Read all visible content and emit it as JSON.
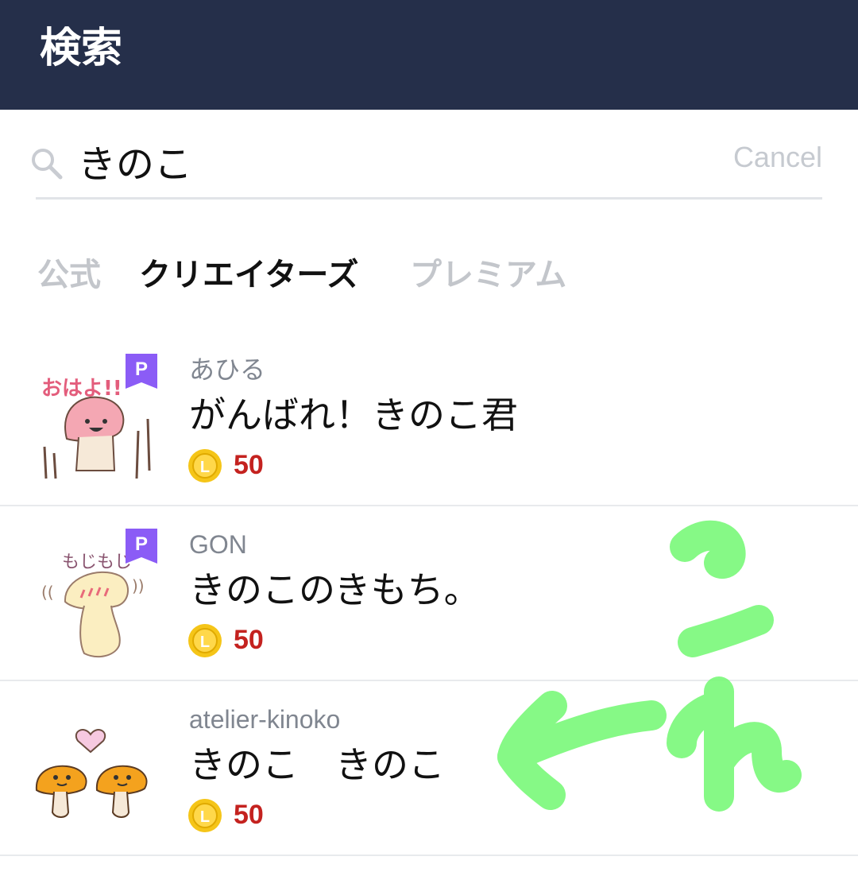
{
  "header": {
    "title": "検索"
  },
  "search": {
    "query": "きのこ",
    "cancel_label": "Cancel"
  },
  "tabs": [
    {
      "label": "公式",
      "active": false
    },
    {
      "label": "クリエイターズ",
      "active": true
    },
    {
      "label": "プレミアム",
      "active": false
    }
  ],
  "results": [
    {
      "author": "あひる",
      "title": "がんばれ！きのこ君",
      "price": "50",
      "premium_badge": "P",
      "thumb_text": "おはよ!!"
    },
    {
      "author": "GON",
      "title": "きのこのきもち。",
      "price": "50",
      "premium_badge": "P",
      "thumb_text": "もじもじ"
    },
    {
      "author": "atelier-kinoko",
      "title": "きのこ　きのこ",
      "price": "50"
    }
  ],
  "coin_letter": "L",
  "annotation": {
    "handwritten_text": "これ",
    "color": "#7cf97c"
  },
  "colors": {
    "header_bg": "#252f4a",
    "price": "#c4221f",
    "badge": "#8b5cf6",
    "coin": "#f5c518"
  }
}
